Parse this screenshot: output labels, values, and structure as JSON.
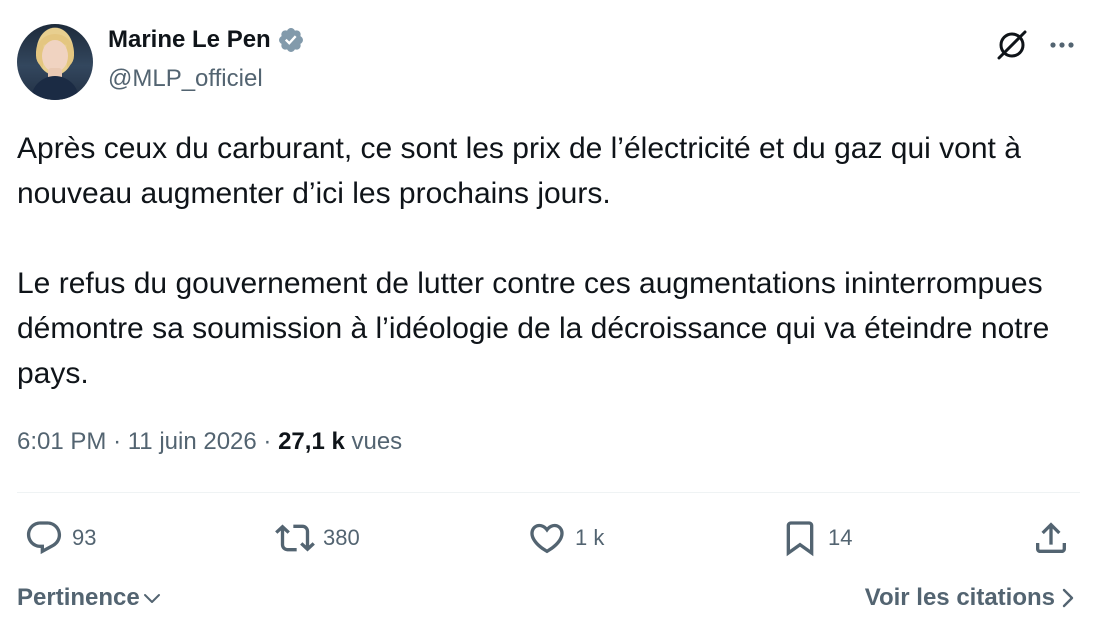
{
  "author": {
    "name": "Marine Le Pen",
    "handle": "@MLP_officiel",
    "verified": true
  },
  "icons": {
    "verified": "verified-badge-icon",
    "grok": "grok-icon",
    "more": "more-options-icon",
    "reply": "reply-icon",
    "retweet": "retweet-icon",
    "like": "like-icon",
    "bookmark": "bookmark-icon",
    "share": "share-icon"
  },
  "tweet": {
    "paragraph1": "Après ceux du carburant, ce sont les prix de l’électricité et du gaz qui vont à nouveau augmenter d’ici les prochains jours.",
    "paragraph2": "Le refus du gouvernement de lutter contre ces augmentations ininterrompues démontre sa soumission à l’idéologie de la décroissance qui va éteindre notre pays."
  },
  "meta": {
    "time": "6:01 PM",
    "separator": "·",
    "date": "11 juin 2026",
    "views_count": "27,1 k",
    "views_label": "vues"
  },
  "actions": {
    "replies": "93",
    "retweets": "380",
    "likes": "1 k",
    "bookmarks": "14"
  },
  "footer": {
    "sort_label": "Pertinence",
    "quotes_label": "Voir les citations"
  },
  "colors": {
    "text_primary": "#0f1419",
    "text_secondary": "#536471",
    "verified": "#829aab",
    "divider": "#eff3f4"
  }
}
